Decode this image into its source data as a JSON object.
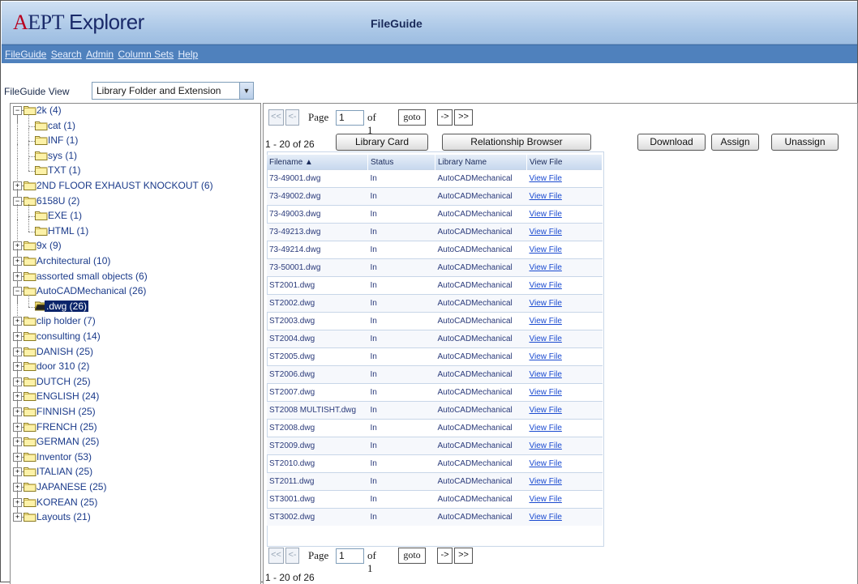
{
  "app": {
    "logo": "A",
    "logo_rest": "EPT",
    "logo_suffix": "Explorer",
    "title": "FileGuide"
  },
  "menu": [
    "FileGuide",
    "Search",
    "Admin",
    "Column Sets",
    "Help"
  ],
  "view": {
    "label": "FileGuide View",
    "selected": "Library Folder and Extension"
  },
  "tree": [
    {
      "label": "2k (4)",
      "level": 0,
      "exp": "minus"
    },
    {
      "label": "cat (1)",
      "level": 1
    },
    {
      "label": "INF (1)",
      "level": 1
    },
    {
      "label": "sys (1)",
      "level": 1
    },
    {
      "label": "TXT (1)",
      "level": 1,
      "last": true
    },
    {
      "label": "2ND FLOOR EXHAUST KNOCKOUT (6)",
      "level": 0,
      "exp": "plus"
    },
    {
      "label": "6158U (2)",
      "level": 0,
      "exp": "minus"
    },
    {
      "label": "EXE (1)",
      "level": 1
    },
    {
      "label": "HTML (1)",
      "level": 1,
      "last": true
    },
    {
      "label": "9x (9)",
      "level": 0,
      "exp": "plus"
    },
    {
      "label": "Architectural (10)",
      "level": 0,
      "exp": "plus"
    },
    {
      "label": "assorted small objects (6)",
      "level": 0,
      "exp": "plus"
    },
    {
      "label": "AutoCADMechanical (26)",
      "level": 0,
      "exp": "minus"
    },
    {
      "label": ".dwg (26)",
      "level": 1,
      "last": true,
      "selected": true
    },
    {
      "label": "clip holder (7)",
      "level": 0,
      "exp": "plus"
    },
    {
      "label": "consulting (14)",
      "level": 0,
      "exp": "plus"
    },
    {
      "label": "DANISH (25)",
      "level": 0,
      "exp": "plus"
    },
    {
      "label": "door 310 (2)",
      "level": 0,
      "exp": "plus"
    },
    {
      "label": "DUTCH (25)",
      "level": 0,
      "exp": "plus"
    },
    {
      "label": "ENGLISH (24)",
      "level": 0,
      "exp": "plus"
    },
    {
      "label": "FINNISH (25)",
      "level": 0,
      "exp": "plus"
    },
    {
      "label": "FRENCH (25)",
      "level": 0,
      "exp": "plus"
    },
    {
      "label": "GERMAN (25)",
      "level": 0,
      "exp": "plus"
    },
    {
      "label": "Inventor (53)",
      "level": 0,
      "exp": "plus"
    },
    {
      "label": "ITALIAN (25)",
      "level": 0,
      "exp": "plus"
    },
    {
      "label": "JAPANESE (25)",
      "level": 0,
      "exp": "plus"
    },
    {
      "label": "KOREAN (25)",
      "level": 0,
      "exp": "plus"
    },
    {
      "label": "Layouts (21)",
      "level": 0,
      "exp": "plus"
    }
  ],
  "pager": {
    "first": "<<",
    "prev": "<-",
    "page_label": "Page",
    "page_value": "1",
    "of": "of 1",
    "goto": "goto",
    "next": "->",
    "last": ">>"
  },
  "count": "1 - 20 of 26",
  "actions": {
    "library_card": "Library Card",
    "relationship_browser": "Relationship Browser",
    "download": "Download",
    "assign": "Assign",
    "unassign": "Unassign"
  },
  "columns": [
    "Filename ▲",
    "Status",
    "Library Name",
    "View File"
  ],
  "rows": [
    [
      "73-49001.dwg",
      "In",
      "AutoCADMechanical",
      "View File"
    ],
    [
      "73-49002.dwg",
      "In",
      "AutoCADMechanical",
      "View File"
    ],
    [
      "73-49003.dwg",
      "In",
      "AutoCADMechanical",
      "View File"
    ],
    [
      "73-49213.dwg",
      "In",
      "AutoCADMechanical",
      "View File"
    ],
    [
      "73-49214.dwg",
      "In",
      "AutoCADMechanical",
      "View File"
    ],
    [
      "73-50001.dwg",
      "In",
      "AutoCADMechanical",
      "View File"
    ],
    [
      "ST2001.dwg",
      "In",
      "AutoCADMechanical",
      "View File"
    ],
    [
      "ST2002.dwg",
      "In",
      "AutoCADMechanical",
      "View File"
    ],
    [
      "ST2003.dwg",
      "In",
      "AutoCADMechanical",
      "View File"
    ],
    [
      "ST2004.dwg",
      "In",
      "AutoCADMechanical",
      "View File"
    ],
    [
      "ST2005.dwg",
      "In",
      "AutoCADMechanical",
      "View File"
    ],
    [
      "ST2006.dwg",
      "In",
      "AutoCADMechanical",
      "View File"
    ],
    [
      "ST2007.dwg",
      "In",
      "AutoCADMechanical",
      "View File"
    ],
    [
      "ST2008 MULTISHT.dwg",
      "In",
      "AutoCADMechanical",
      "View File"
    ],
    [
      "ST2008.dwg",
      "In",
      "AutoCADMechanical",
      "View File"
    ],
    [
      "ST2009.dwg",
      "In",
      "AutoCADMechanical",
      "View File"
    ],
    [
      "ST2010.dwg",
      "In",
      "AutoCADMechanical",
      "View File"
    ],
    [
      "ST2011.dwg",
      "In",
      "AutoCADMechanical",
      "View File"
    ],
    [
      "ST3001.dwg",
      "In",
      "AutoCADMechanical",
      "View File"
    ],
    [
      "ST3002.dwg",
      "In",
      "AutoCADMechanical",
      "View File"
    ]
  ],
  "colors": {
    "header_bg": "#a9c6e6",
    "menubar_bg": "#4f81bd",
    "link": "#1a4ad0",
    "selection": "#0a246a"
  }
}
